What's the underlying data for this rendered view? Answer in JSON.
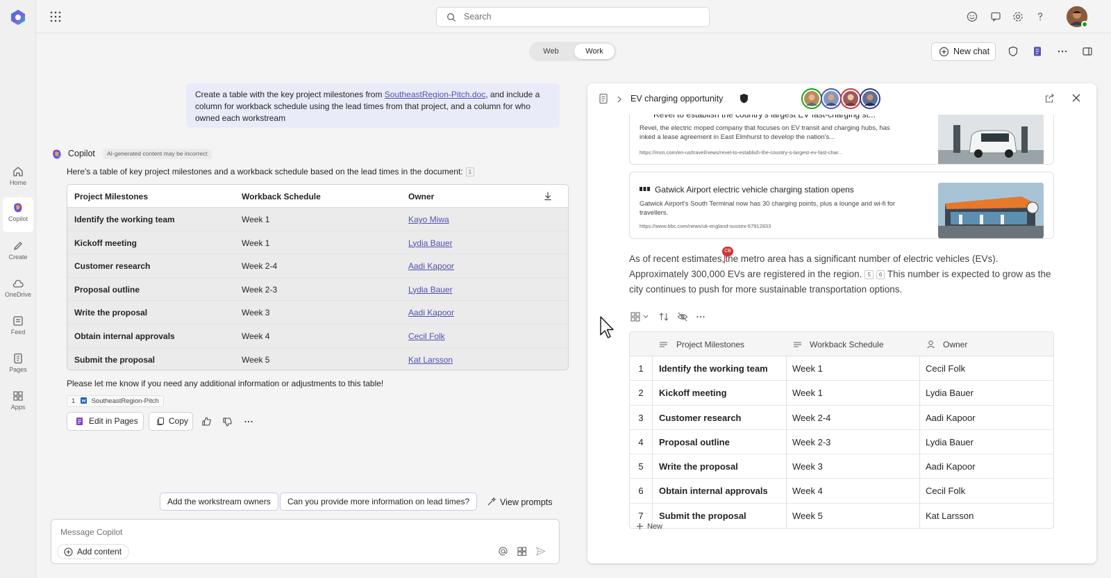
{
  "topbar": {
    "search_placeholder": "Search"
  },
  "rail": {
    "items": [
      {
        "label": "Home"
      },
      {
        "label": "Copilot"
      },
      {
        "label": "Create"
      },
      {
        "label": "OneDrive"
      },
      {
        "label": "Feed"
      },
      {
        "label": "Pages"
      },
      {
        "label": "Apps"
      }
    ]
  },
  "mode_toggle": {
    "web": "Web",
    "work": "Work",
    "selected": "Work"
  },
  "header_actions": {
    "new_chat": "New chat"
  },
  "prompt": {
    "before": "Create a table with the key project milestones from ",
    "link": "SoutheastRegion-Pitch.doc",
    "after": ", and include a column for workback schedule using the lead times from that project, and a column for who owned each workstream"
  },
  "response": {
    "sender": "Copilot",
    "badge": "AI-generated content may be incorrect",
    "intro": "Here's a table of key project milestones and a workback schedule based on the lead times in the document:",
    "intro_cite": "1",
    "table": {
      "headers": [
        "Project Milestones",
        "Workback Schedule",
        "Owner"
      ],
      "rows": [
        [
          "Identify the working team",
          "Week 1",
          "Kayo Miwa"
        ],
        [
          "Kickoff meeting",
          "Week 1",
          "Lydia Bauer"
        ],
        [
          "Customer research",
          "Week 2-4",
          "Aadi Kapoor"
        ],
        [
          "Proposal outline",
          "Week 2-3",
          "Lydia Bauer"
        ],
        [
          "Write the proposal",
          "Week 3",
          "Aadi Kapoor"
        ],
        [
          "Obtain internal approvals",
          "Week 4",
          "Cecil Folk"
        ],
        [
          "Submit the proposal",
          "Week 5",
          "Kat Larsson"
        ]
      ]
    },
    "closing": "Please let me know if you need any additional information or adjustments to this table!",
    "source": {
      "num": "1",
      "name": "SoutheastRegion-Pitch"
    },
    "actions": {
      "edit": "Edit in Pages",
      "copy": "Copy"
    }
  },
  "suggestions": [
    "Add the workstream owners",
    "Can you provide more information on lead times?"
  ],
  "view_prompts": "View prompts",
  "composer": {
    "placeholder": "Message Copilot",
    "add_content": "Add content"
  },
  "panel": {
    "title": "EV charging opportunity",
    "cards": [
      {
        "title": "Revel to establish the country's largest EV fast-charging st...",
        "desc": "Revel, the electric moped company that focuses on EV transit and charging hubs, has inked a lease agreement in East Elmhurst to develop the nation's...",
        "url": "https://msn.com/en-us/travel/news/revel-to-establish-the-country-s-largest-ev-fast-char..."
      },
      {
        "title": "Gatwick Airport electric vehicle charging station opens",
        "desc": "Gatwick Airport's South Terminal now has 30 charging points, plus a lounge and wi-fi for travellers.",
        "url": "https://www.bbc.com/news/uk-england-sussex-67912833"
      }
    ],
    "paragraph": {
      "p1": "As of recent estimates,",
      "p2": "the metro area has a significant number of electric vehicles (EVs). Approximately 300,000 EVs are registered in the region.",
      "c1": "5",
      "c2": "6",
      "p3": "This number is expected to grow as the city continues to push for more sustainable transportation options.",
      "cursor_tag": "CB"
    },
    "table": {
      "headers": [
        "Project Milestones",
        "Workback Schedule",
        "Owner"
      ],
      "rows": [
        [
          "1",
          "Identify the working team",
          "Week 1",
          "Cecil Folk"
        ],
        [
          "2",
          "Kickoff meeting",
          "Week 1",
          "Lydia Bauer"
        ],
        [
          "3",
          "Customer research",
          "Week 2-4",
          "Aadi Kapoor"
        ],
        [
          "4",
          "Proposal outline",
          "Week 2-3",
          "Lydia Bauer"
        ],
        [
          "5",
          "Write the proposal",
          "Week 3",
          "Aadi Kapoor"
        ],
        [
          "6",
          "Obtain internal approvals",
          "Week 4",
          "Cecil Folk"
        ],
        [
          "7",
          "Submit the proposal",
          "Week 5",
          "Kat Larsson"
        ]
      ]
    },
    "new_label": "New"
  },
  "colors": {
    "accent": "#4f52b2",
    "prompt_bg": "#e9ebf8",
    "presence": "#13a10e",
    "cursor_tag": "#d13438"
  }
}
